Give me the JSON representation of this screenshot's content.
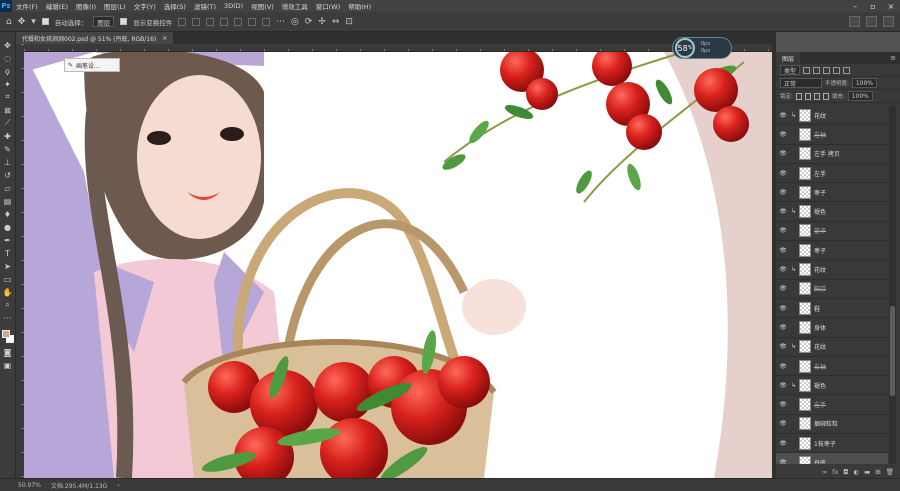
{
  "menu": [
    "文件(F)",
    "编辑(E)",
    "图像(I)",
    "图层(L)",
    "文字(Y)",
    "选择(S)",
    "滤镜(T)",
    "3D(D)",
    "视图(V)",
    "增效工具",
    "窗口(W)",
    "帮助(H)"
  ],
  "app_logo": "Ps",
  "options": {
    "auto_select_label": "自动选择：",
    "auto_select_value": "图层",
    "transform_label": "显示变换控件"
  },
  "document_tab": {
    "title": "代餐和女孩涧涧002.psd @ 51% (丹底, RGB/16)",
    "close": "×"
  },
  "brush_tip": "画笔设...",
  "zoom_hud": {
    "value": "58",
    "unit": "%",
    "line1": "0px",
    "line2": "0px"
  },
  "status": {
    "zoom": "50.97%",
    "doc": "文档:295.4M/1.13G"
  },
  "colors": {
    "foreground": "#c9a98a",
    "background": "#ffffff"
  },
  "layers_panel": {
    "tab": "图层",
    "kind_label": "类型",
    "blend_mode": "正常",
    "opacity_label": "不透明度:",
    "opacity": "100%",
    "lock_label": "锁定:",
    "fill_label": "填充:",
    "fill": "100%",
    "layers": [
      {
        "name": "花纹",
        "clip": true,
        "strike": false
      },
      {
        "name": "左袖",
        "clip": false,
        "strike": true
      },
      {
        "name": "左手 拷贝",
        "clip": false,
        "strike": false
      },
      {
        "name": "左手",
        "clip": false,
        "strike": false
      },
      {
        "name": "枣子",
        "clip": false,
        "strike": false
      },
      {
        "name": "褪色",
        "clip": true,
        "strike": false
      },
      {
        "name": "篮子",
        "clip": false,
        "strike": true
      },
      {
        "name": "枣子",
        "clip": false,
        "strike": false
      },
      {
        "name": "花纹",
        "clip": true,
        "strike": false
      },
      {
        "name": "脑袋",
        "clip": false,
        "strike": true
      },
      {
        "name": "鞋",
        "clip": false,
        "strike": false
      },
      {
        "name": "身体",
        "clip": false,
        "strike": false
      },
      {
        "name": "花纹",
        "clip": true,
        "strike": false
      },
      {
        "name": "右袖",
        "clip": false,
        "strike": true
      },
      {
        "name": "褪色",
        "clip": true,
        "strike": false
      },
      {
        "name": "左手",
        "clip": false,
        "strike": true
      },
      {
        "name": "捆绑粒粒",
        "clip": false,
        "strike": false
      },
      {
        "name": "1枝枣子",
        "clip": false,
        "strike": false
      },
      {
        "name": "丹底",
        "clip": false,
        "strike": false,
        "selected": true
      }
    ]
  }
}
